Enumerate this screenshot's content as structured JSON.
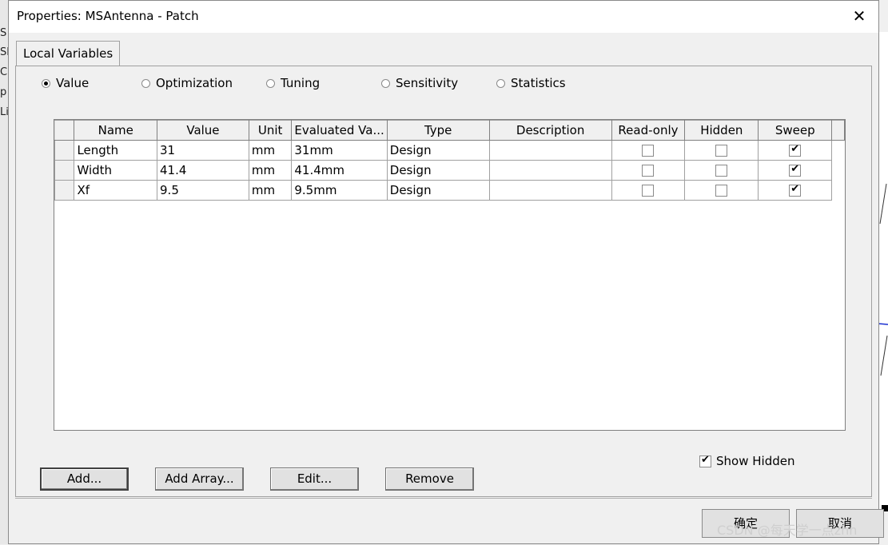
{
  "window": {
    "title": "Properties: MSAntenna - Patch",
    "close_glyph": "✕"
  },
  "background": {
    "left_letters": [
      "S",
      "Sl",
      "C",
      "p",
      "Li"
    ]
  },
  "tabs": [
    {
      "label": "Local Variables",
      "active": true
    }
  ],
  "radio_options": [
    {
      "label": "Value",
      "selected": true
    },
    {
      "label": "Optimization",
      "selected": false
    },
    {
      "label": "Tuning",
      "selected": false
    },
    {
      "label": "Sensitivity",
      "selected": false
    },
    {
      "label": "Statistics",
      "selected": false
    }
  ],
  "table": {
    "columns": [
      "Name",
      "Value",
      "Unit",
      "Evaluated Va...",
      "Type",
      "Description",
      "Read-only",
      "Hidden",
      "Sweep"
    ],
    "rows": [
      {
        "name": "Length",
        "value": "31",
        "unit": "mm",
        "evaluated": "31mm",
        "type": "Design",
        "description": "",
        "read_only": false,
        "hidden": false,
        "sweep": true
      },
      {
        "name": "Width",
        "value": "41.4",
        "unit": "mm",
        "evaluated": "41.4mm",
        "type": "Design",
        "description": "",
        "read_only": false,
        "hidden": false,
        "sweep": true
      },
      {
        "name": "Xf",
        "value": "9.5",
        "unit": "mm",
        "evaluated": "9.5mm",
        "type": "Design",
        "description": "",
        "read_only": false,
        "hidden": false,
        "sweep": true
      }
    ]
  },
  "show_hidden": {
    "label": "Show Hidden",
    "checked": true
  },
  "buttons": {
    "add": "Add...",
    "add_array": "Add Array...",
    "edit": "Edit...",
    "remove": "Remove"
  },
  "footer": {
    "ok": "确定",
    "cancel": "取消"
  },
  "watermark": "CSDN @每天学一点zhn"
}
